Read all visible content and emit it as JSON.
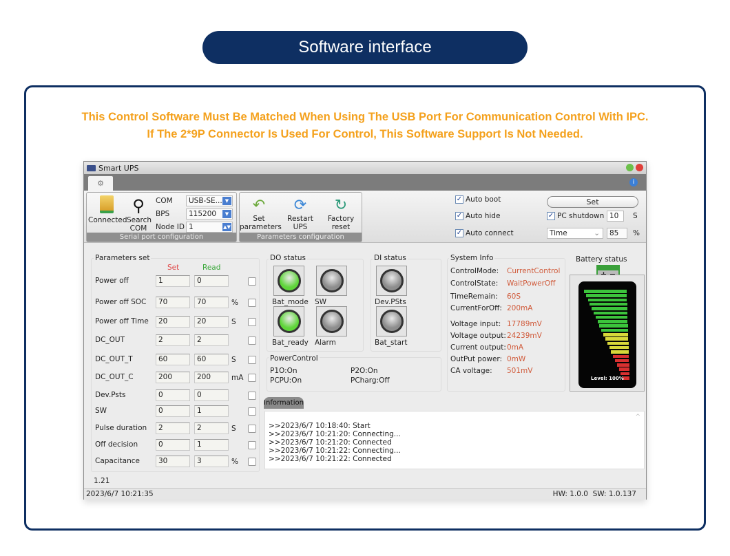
{
  "banner": {
    "title": "Software interface",
    "note_line1": "This Control Software Must Be Matched When Using The USB Port For Communication Control With IPC.",
    "note_line2": "If The 2*9P Connector Is Used For Control, This Software Support Is Not Needed."
  },
  "window": {
    "title": "Smart UPS"
  },
  "serial": {
    "connected_label": "Connected",
    "search_label_1": "Search",
    "search_label_2": "COM",
    "com_label": "COM",
    "com_value": "USB-SE...",
    "bps_label": "BPS",
    "bps_value": "115200",
    "node_label": "Node ID",
    "node_value": "1",
    "caption": "Serial port configuration"
  },
  "paramcfg": {
    "set_1": "Set",
    "set_2": "parameters",
    "restart_1": "Restart",
    "restart_2": "UPS",
    "factory_1": "Factory",
    "factory_2": "reset",
    "caption": "Parameters configuration"
  },
  "options": {
    "auto_boot": "Auto boot",
    "auto_hide": "Auto hide",
    "auto_connect": "Auto connect",
    "set_button": "Set",
    "pc_shutdown": "PC shutdown",
    "shutdown_value": "10",
    "shutdown_unit": "S",
    "mode_value": "Time",
    "percent_value": "85",
    "percent_unit": "%",
    "checked": true
  },
  "params": {
    "title": "Parameters set",
    "set_header": "Set",
    "read_header": "Read",
    "rows": [
      {
        "label": "Power off",
        "set": "1",
        "read": "0",
        "unit": ""
      },
      {
        "label": "Power off SOC",
        "set": "70",
        "read": "70",
        "unit": "%"
      },
      {
        "label": "Power off Time",
        "set": "20",
        "read": "20",
        "unit": "S"
      },
      {
        "label": "DC_OUT",
        "set": "2",
        "read": "2",
        "unit": ""
      },
      {
        "label": "DC_OUT_T",
        "set": "60",
        "read": "60",
        "unit": "S"
      },
      {
        "label": "DC_OUT_C",
        "set": "200",
        "read": "200",
        "unit": "mA"
      },
      {
        "label": "Dev.Psts",
        "set": "0",
        "read": "0",
        "unit": ""
      },
      {
        "label": "SW",
        "set": "0",
        "read": "1",
        "unit": ""
      },
      {
        "label": "Pulse duration",
        "set": "2",
        "read": "2",
        "unit": "S"
      },
      {
        "label": "Off decision",
        "set": "0",
        "read": "1",
        "unit": ""
      },
      {
        "label": "Capacitance",
        "set": "30",
        "read": "3",
        "unit": "%"
      }
    ]
  },
  "do_status": {
    "title": "DO status",
    "items": [
      {
        "label": "Bat_mode",
        "on": true
      },
      {
        "label": "SW",
        "on": false
      },
      {
        "label": "Bat_ready",
        "on": true
      },
      {
        "label": "Alarm",
        "on": false
      }
    ]
  },
  "di_status": {
    "title": "DI status",
    "items": [
      {
        "label": "Dev.PSts",
        "on": false
      },
      {
        "label": "Bat_start",
        "on": false
      }
    ]
  },
  "power_control": {
    "title": "PowerControl",
    "p1o": "P1O:On",
    "p2o": "P2O:On",
    "pcpu": "PCPU:On",
    "pcharg": "PCharg:Off"
  },
  "system_info": {
    "title": "System Info",
    "rows": [
      {
        "label": "ControlMode:",
        "value": "CurrentControl"
      },
      {
        "label": "ControlState:",
        "value": "WaitPowerOff"
      },
      {
        "label": "TimeRemain:",
        "value": "60S"
      },
      {
        "label": "CurrentForOff:",
        "value": "200mA"
      },
      {
        "label": "Voltage input:",
        "value": "17789mV"
      },
      {
        "label": "Voltage output:",
        "value": "24239mV"
      },
      {
        "label": "Current output:",
        "value": "0mA"
      },
      {
        "label": "OutPut power:",
        "value": "0mW"
      },
      {
        "label": "CA voltage:",
        "value": "501mV"
      }
    ]
  },
  "battery": {
    "title": "Battery status",
    "level_text": "Level: 100%",
    "level_percent": 100,
    "terminals": "+ −"
  },
  "information": {
    "tab": "Information",
    "log": [
      ">>2023/6/7 10:18:40: Start",
      ">>2023/6/7 10:21:20: Connecting...",
      ">>2023/6/7 10:21:20: Connected",
      ">>2023/6/7 10:21:22: Connecting...",
      ">>2023/6/7 10:21:22: Connected"
    ]
  },
  "footer": {
    "version": "1.21",
    "datetime": "2023/6/7 10:21:35",
    "hw_sw": "HW: 1.0.0  SW: 1.0.137"
  },
  "colors": {
    "navy": "#0e2f62",
    "orange": "#f4a11d",
    "led_on": "#5fd53a",
    "led_off": "#8d8d8d",
    "value_red": "#d05a3a"
  }
}
